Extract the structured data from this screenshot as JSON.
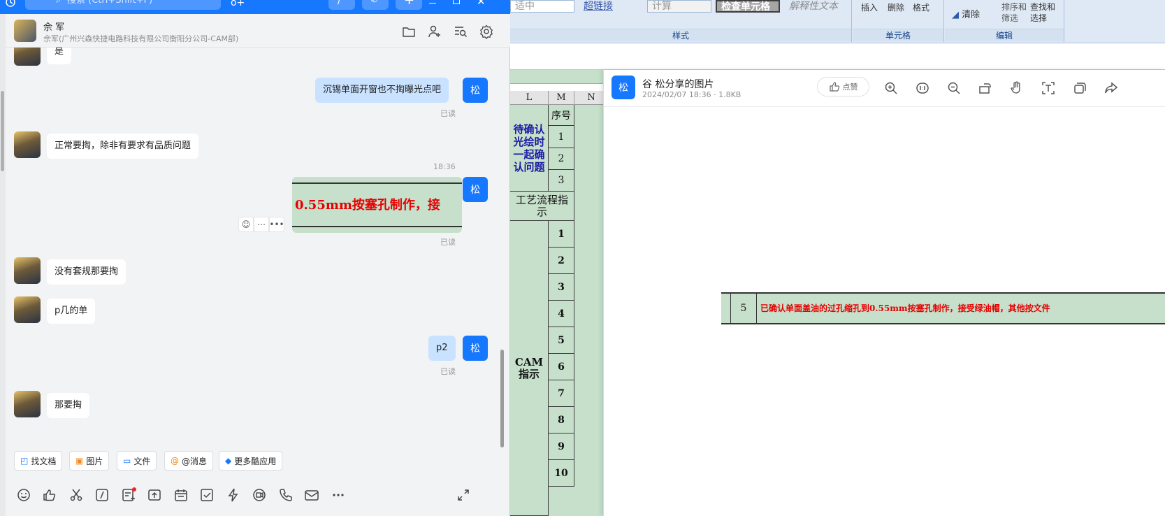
{
  "ribbon": {
    "style_boxes": [
      "适中",
      "超链接",
      "计算",
      "检查单元格",
      "解释性文本"
    ],
    "style_group": "样式",
    "cells_buttons": [
      "插入",
      "删除",
      "格式"
    ],
    "cells_group": "单元格",
    "edit_buttons": [
      "清除",
      "排序和筛选",
      "查找和选择"
    ],
    "edit_group": "编辑"
  },
  "sheet": {
    "col_headers": [
      "L",
      "M",
      "N"
    ],
    "col_m_header": "序号",
    "confirm_label": "待确认光绘时一起确认问题",
    "confirm_rows": [
      "1",
      "2",
      "3"
    ],
    "process_label": "工艺流程指示",
    "cam_label": "CAM指示",
    "cam_rows": [
      "1",
      "2",
      "3",
      "4",
      "5",
      "6",
      "7",
      "8",
      "9",
      "10"
    ]
  },
  "viewer": {
    "avatar": "松",
    "title": "谷  松分享的图片",
    "subtitle": "2024/02/07 18:36 · 1.8KB",
    "like": "点赞",
    "row_number": "5",
    "row_text": "已确认单面盖油的过孔缩孔到0.55mm按塞孔制作，接受绿油帽，其他按文件"
  },
  "chat": {
    "search_placeholder": "搜索 (Ctrl+Shift+F)",
    "contact_name": "佘  军",
    "contact_org": "佘军(广州兴森快捷电路科技有限公司衡阳分公司-CAM部)",
    "me_avatar": "松",
    "messages": [
      {
        "from": "them",
        "text": "是"
      },
      {
        "from": "me",
        "text": "沉锡单面开窗也不掏曝光点吧",
        "status": "已读"
      },
      {
        "from": "them",
        "text": "正常要掏，除非有要求有品质问题"
      },
      {
        "time": "18:36"
      },
      {
        "from": "me",
        "image_text": "0.55mm按塞孔制作，接",
        "status": "已读"
      },
      {
        "from": "them",
        "text": "没有套规那要掏"
      },
      {
        "from": "them",
        "text": "p几的单"
      },
      {
        "from": "me",
        "text": "p2",
        "status": "已读"
      },
      {
        "from": "them",
        "text": "那要掏"
      }
    ],
    "quick_actions": [
      "找文档",
      "图片",
      "文件",
      "@消息",
      "更多酷应用"
    ]
  }
}
